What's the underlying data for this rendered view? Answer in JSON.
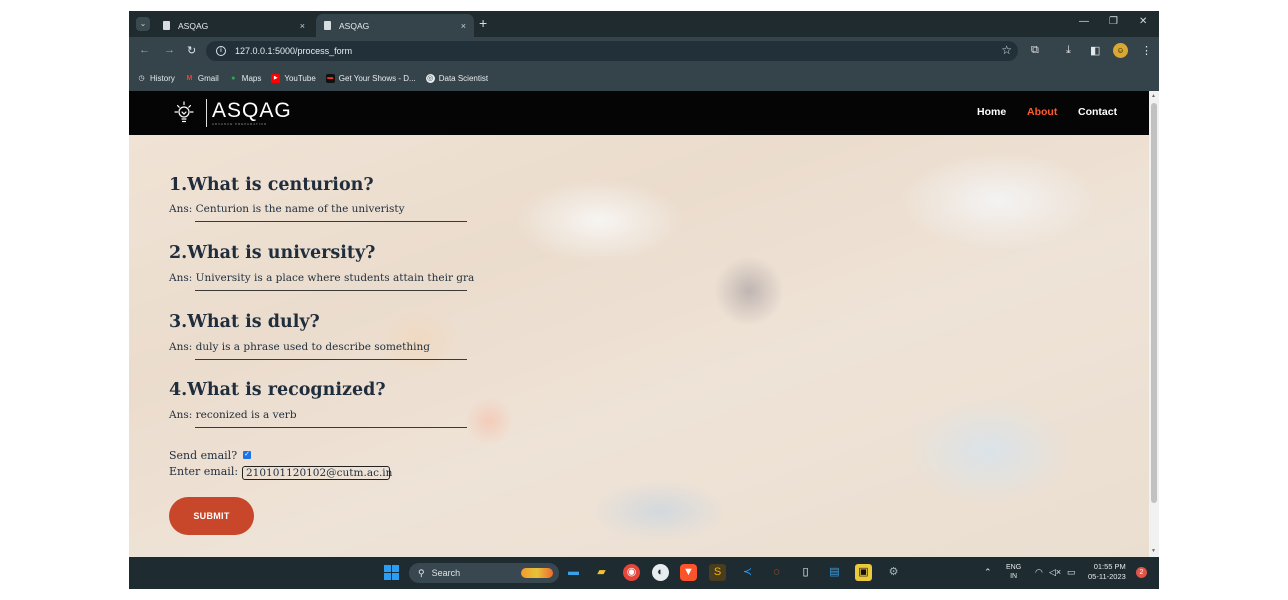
{
  "browser": {
    "tabs": [
      {
        "title": "ASQAG",
        "close": "×"
      },
      {
        "title": "ASQAG",
        "close": "×"
      }
    ],
    "new_tab": "+",
    "url": "127.0.0.1:5000/process_form",
    "bookmarks": [
      "History",
      "Gmail",
      "Maps",
      "YouTube",
      "Get Your Shows - D...",
      "Data Scientist"
    ]
  },
  "site": {
    "logo_text": "ASQAG",
    "logo_subtitle": "ADVANCE PREPARATION",
    "nav": [
      "Home",
      "About",
      "Contact"
    ],
    "active_nav": "About",
    "accent_color": "#ff5a2e"
  },
  "qa": [
    {
      "question": "1.What is centurion?",
      "answer": "Ans: Centurion is the name of the univeristy"
    },
    {
      "question": "2.What is university?",
      "answer": "Ans: University is a place where students attain their gra"
    },
    {
      "question": "3.What is duly?",
      "answer": "Ans: duly is a phrase used to describe something"
    },
    {
      "question": "4.What is recognized?",
      "answer": "Ans: reconized is a verb"
    }
  ],
  "form": {
    "send_email_label": "Send email?",
    "send_email_checked": true,
    "email_label": "Enter email:",
    "email_value": "210101120102@cutm.ac.in",
    "submit_label": "SUBMIT",
    "submit_color": "#c8462a"
  },
  "taskbar": {
    "search_label": "Search",
    "lang_top": "ENG",
    "lang_bottom": "IN",
    "time": "01:55 PM",
    "date": "05-11-2023",
    "notification_count": "2"
  }
}
